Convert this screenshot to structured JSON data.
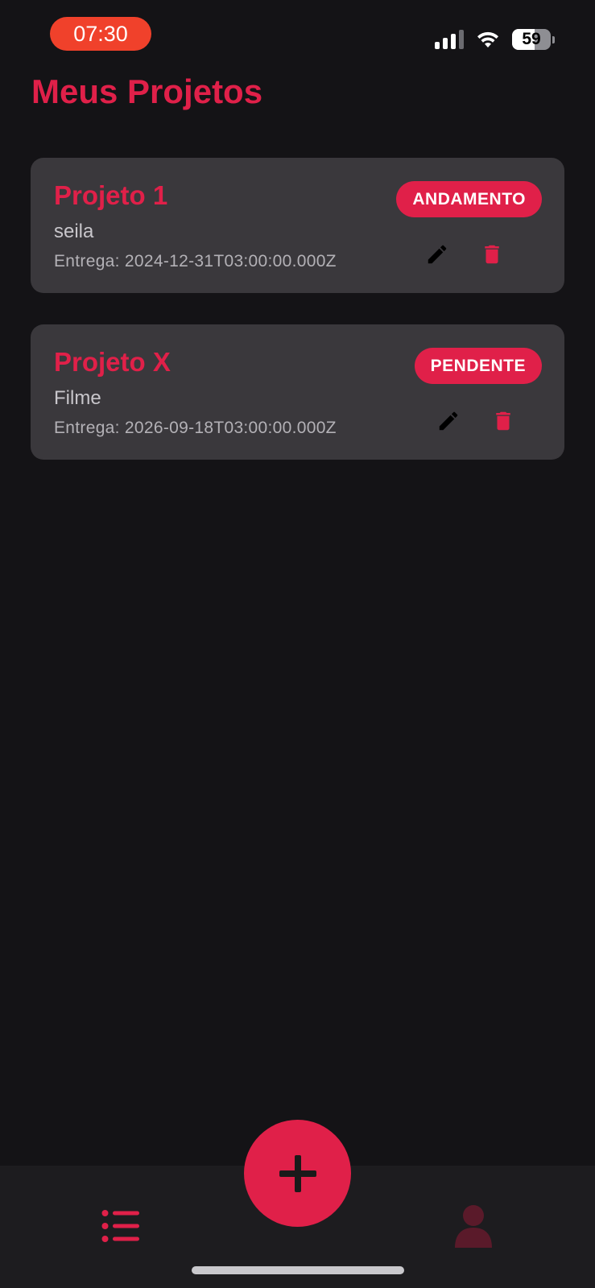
{
  "status_bar": {
    "time": "07:30",
    "battery_level": "59",
    "signal_bars_active": 3,
    "signal_bars_total": 4
  },
  "header": {
    "title": "Meus Projetos"
  },
  "projects": [
    {
      "title": "Projeto 1",
      "description": "seila",
      "due_text": "Entrega: 2024-12-31T03:00:00.000Z",
      "status": "ANDAMENTO"
    },
    {
      "title": "Projeto X",
      "description": "Filme",
      "due_text": "Entrega: 2026-09-18T03:00:00.000Z",
      "status": "PENDENTE"
    }
  ],
  "icons": {
    "edit": "pencil-icon",
    "delete": "trash-icon",
    "add": "plus-icon",
    "list": "list-icon",
    "profile": "user-icon"
  },
  "colors": {
    "accent": "#e02049",
    "background": "#141316",
    "card": "#3a383c",
    "tab_bar": "#1d1c1f",
    "status_time_pill": "#f0412b",
    "profile_tab_inactive": "#5a1a2a"
  }
}
